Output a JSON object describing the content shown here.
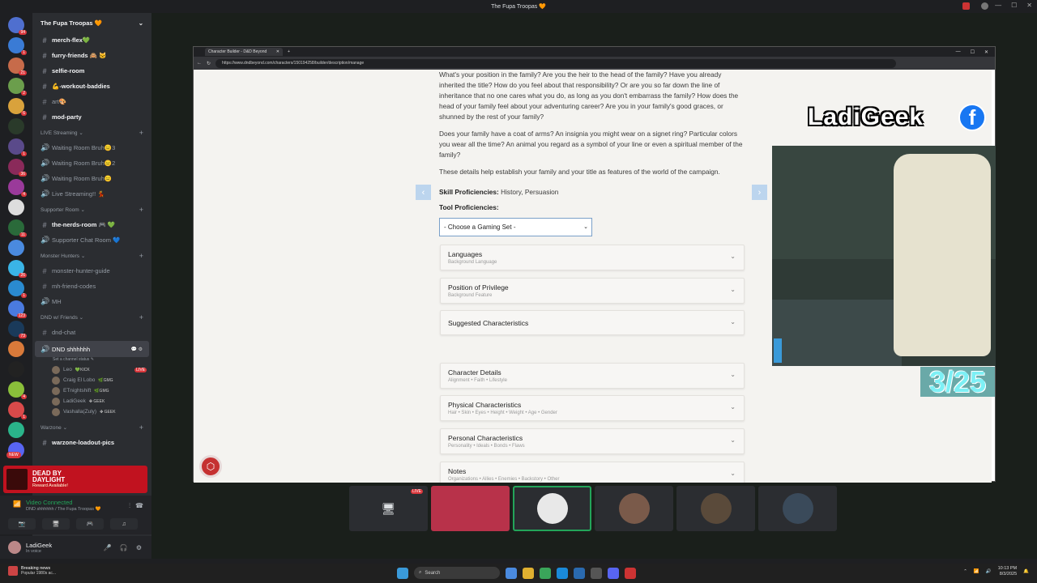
{
  "window": {
    "title": "The Fupa Troopas 🧡"
  },
  "servers": [
    {
      "color": "#4f6fcf",
      "badge": "94"
    },
    {
      "color": "#3a7bd5",
      "badge": "1"
    },
    {
      "color": "#c76b4a",
      "badge": "21"
    },
    {
      "color": "#6b9e4c",
      "badge": "2"
    },
    {
      "color": "#d9a23c",
      "badge": "6"
    },
    {
      "color": "#2a3a2a",
      "badge": ""
    },
    {
      "color": "#5a4a8a",
      "badge": "1"
    },
    {
      "color": "#8a2a5a",
      "badge": "36"
    },
    {
      "color": "#9a3a9a",
      "badge": "4"
    },
    {
      "color": "#ddd",
      "badge": ""
    },
    {
      "color": "#2a6a3a",
      "badge": "11"
    },
    {
      "color": "#4a8adf",
      "badge": ""
    },
    {
      "color": "#3ab4e6",
      "badge": "26"
    },
    {
      "color": "#2a8acf",
      "badge": "1"
    },
    {
      "color": "#4a7adf",
      "badge": "123"
    },
    {
      "color": "#1a3a5a",
      "badge": "73"
    },
    {
      "color": "#d97a3a",
      "badge": ""
    },
    {
      "color": "#222",
      "badge": ""
    },
    {
      "color": "#8abf3a",
      "badge": "4"
    },
    {
      "color": "#d94a4a",
      "badge": "1"
    },
    {
      "color": "#2ab48a",
      "badge": ""
    },
    {
      "color": "#5865f2",
      "badge": ""
    }
  ],
  "sidebar": {
    "server_name": "The Fupa Troopas 🧡",
    "channels_top": [
      {
        "name": "merch-flex💚",
        "type": "text",
        "bold": true
      },
      {
        "name": "furry-friends 🙈 🐱",
        "type": "text",
        "bold": true
      },
      {
        "name": "selfie-room",
        "type": "text",
        "bold": true
      },
      {
        "name": "💪-workout-baddies",
        "type": "text",
        "bold": true
      },
      {
        "name": "art🎨",
        "type": "text",
        "bold": false
      },
      {
        "name": "mod-party",
        "type": "text",
        "bold": true
      }
    ],
    "live_streaming": {
      "category": "LIVE Streaming ⌄",
      "channels": [
        {
          "name": "Waiting Room Bruh😑3"
        },
        {
          "name": "Waiting Room Bruh😑2"
        },
        {
          "name": "Waiting Room Bruh😑"
        },
        {
          "name": "Live Streaming!! 💃"
        }
      ]
    },
    "supporter_room": {
      "category": "Supporter Room ⌄",
      "channels": [
        {
          "name": "the-nerds-room 🎮 💚",
          "type": "text",
          "bold": true
        },
        {
          "name": "Supporter Chat Room 💙",
          "type": "voice",
          "bold": false
        }
      ]
    },
    "monster_hunters": {
      "category": "Monster Hunters ⌄",
      "channels": [
        {
          "name": "monster-hunter-guide",
          "type": "text"
        },
        {
          "name": "mh-friend-codes",
          "type": "text"
        },
        {
          "name": "MH",
          "type": "voice"
        }
      ]
    },
    "dnd": {
      "category": "DND w/ Friends ⌄",
      "channels": [
        {
          "name": "dnd-chat",
          "type": "text"
        }
      ],
      "active_voice": {
        "name": "DND shhhhhh",
        "status": "Set a channel status ✎"
      },
      "users": [
        {
          "name": "Leo",
          "tag": "💚KICK",
          "live": "LIVE"
        },
        {
          "name": "Craig El Lobo",
          "tag": "🌿GMG",
          "live": ""
        },
        {
          "name": "ETnightshift",
          "tag": "🌿GMG",
          "live": ""
        },
        {
          "name": "LadiGeek",
          "tag": "✤ GEEK",
          "live": ""
        },
        {
          "name": "Vashalla(Zuly)",
          "tag": "✤ GEEK",
          "live": ""
        }
      ]
    },
    "warzone": {
      "category": "Warzone ⌄",
      "channels": [
        {
          "name": "warzone-loadout-pics",
          "type": "text",
          "bold": true
        }
      ]
    },
    "new_badge": "NEW"
  },
  "promo": {
    "title_line1": "DEAD BY",
    "title_line2": "DAYLIGHT",
    "subtitle": "Reward Available!"
  },
  "voice_connection": {
    "status": "Video Connected",
    "channel": "DND shhhhhh / The Fupa Troopas 🧡"
  },
  "user": {
    "name": "LadiGeek",
    "status": "In voice"
  },
  "browser": {
    "tab_title": "Character Builder - D&D Beyond",
    "url": "https://www.dndbeyond.com/characters/150194258/builder/description/manage"
  },
  "page": {
    "paragraphs": [
      "What's your position in the family? Are you the heir to the head of the family? Have you already inherited the title? How do you feel about that responsibility? Or are you so far down the line of inheritance that no one cares what you do, as long as you don't embarrass the family? How does the head of your family feel about your adventuring career? Are you in your family's good graces, or shunned by the rest of your family?",
      "Does your family have a coat of arms? An insignia you might wear on a signet ring? Particular colors you wear all the time? An animal you regard as a symbol of your line or even a spiritual member of the family?",
      "These details help establish your family and your title as features of the world of the campaign."
    ],
    "skill_label": "Skill Proficiencies:",
    "skill_value": "History, Persuasion",
    "tool_label": "Tool Proficiencies:",
    "tool_select": "- Choose a Gaming Set -",
    "sections": [
      {
        "title": "Languages",
        "subtitle": "Background Language"
      },
      {
        "title": "Position of Privilege",
        "subtitle": "Background Feature"
      },
      {
        "title": "Suggested Characteristics",
        "subtitle": ""
      },
      {
        "title": "Character Details",
        "subtitle": "Alignment • Faith • Lifestyle"
      },
      {
        "title": "Physical Characteristics",
        "subtitle": "Hair • Skin • Eyes • Height • Weight • Age • Gender"
      },
      {
        "title": "Personal Characteristics",
        "subtitle": "Personality • Ideals • Bonds • Flaws"
      },
      {
        "title": "Notes",
        "subtitle": "Organizations • Allies • Enemies • Backstory • Other"
      }
    ]
  },
  "overlay": {
    "brand": "LadiGeek",
    "date": "3/25"
  },
  "tiles": [
    {
      "live": "LIVE",
      "color": "#2b2d31"
    },
    {
      "live": "",
      "color": "#b8324a"
    },
    {
      "live": "",
      "color": "#e8e8e8"
    },
    {
      "live": "",
      "color": "#7a5a4a"
    },
    {
      "live": "",
      "color": "#5a4a3a"
    },
    {
      "live": "",
      "color": "#3a4a5a"
    }
  ],
  "taskbar": {
    "news_title": "Breaking news",
    "news_sub": "Popular 1980s ac...",
    "search_placeholder": "Search",
    "time": "10:13 PM",
    "date": "8/3/2025"
  }
}
